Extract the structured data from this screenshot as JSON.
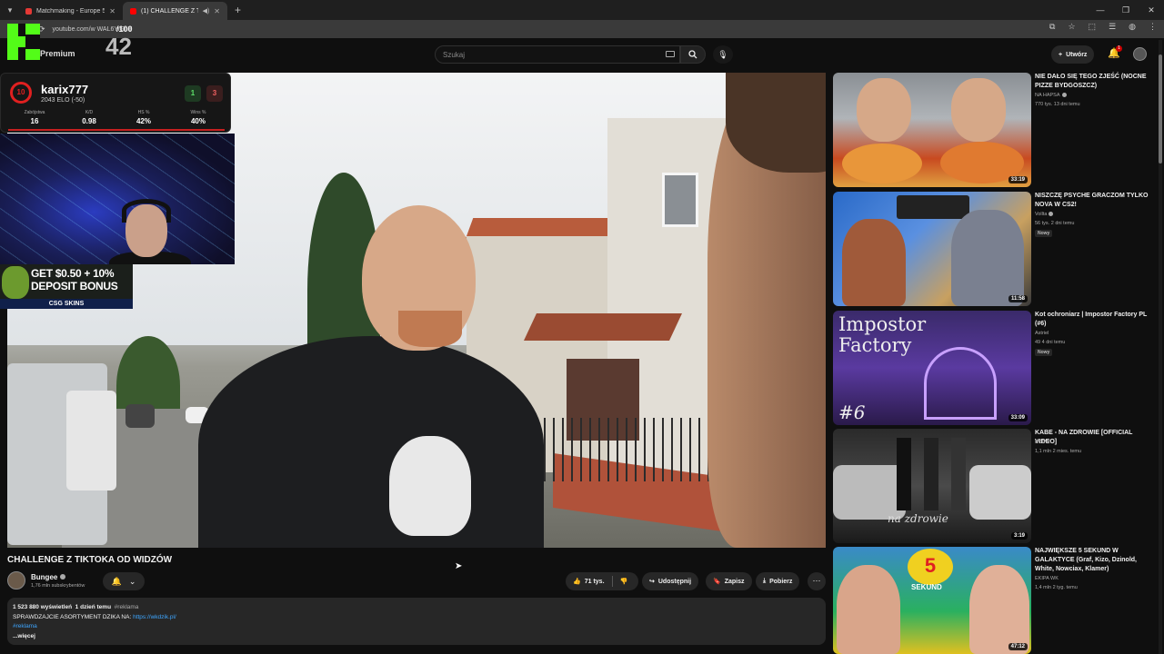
{
  "browser": {
    "tabs": [
      {
        "title": "Matchmaking - Europe 5v5 Qu..."
      },
      {
        "title": "(1) CHALLENGE Z TIKTOKA..."
      }
    ],
    "url": "youtube.com/w          WAL6YiGnY"
  },
  "overlay": {
    "brand_label": "Premium",
    "viewers_small": "/100",
    "viewers_big": "42"
  },
  "faceit": {
    "level": "10",
    "name": "karix777",
    "elo": "2043 ELO (-50)",
    "wins": "1",
    "losses": "3",
    "stats": [
      {
        "label": "Zabójstwa",
        "value": "16"
      },
      {
        "label": "K/D",
        "value": "0.98"
      },
      {
        "label": "HS %",
        "value": "42%"
      },
      {
        "label": "Wins %",
        "value": "40%"
      }
    ]
  },
  "ad": {
    "line1": "GET $0.50 + 10%",
    "line2": "DEPOSIT BONUS",
    "footer": "CSG SKINS"
  },
  "header": {
    "search_placeholder": "Szukaj",
    "create_label": "Utwórz",
    "notif_count": "1"
  },
  "video": {
    "title": "CHALLENGE Z TIKTOKA OD WIDZÓW",
    "channel": "Bungee",
    "subscribers": "1,76 mln subskrybentów",
    "likes": "71 tys.",
    "share_label": "Udostępnij",
    "save_label": "Zapisz",
    "download_label": "Pobierz",
    "views": "1 523 880 wyświetleń",
    "date": "1 dzień temu",
    "hashtag_inline": "#reklama",
    "desc_line": "SPRAWDZAJCIE ASORTYMENT DZIKA NA:",
    "desc_link": "https://wkdzik.pl/",
    "desc_hashtag": "#reklama",
    "more_label": "...więcej"
  },
  "recommendations": [
    {
      "title": "NIE DAŁO SIĘ TEGO ZJEŚĆ (NOCNE PIZZE BYDGOSZCZ)",
      "channel": "NA HAPSA",
      "meta": "770 tys.   13 dni temu",
      "duration": "33:19",
      "badge": ""
    },
    {
      "title": "NISZCZĘ PSYCHE GRACZOM TYLKO NOVA W CS2!",
      "channel": "Vollta",
      "meta": "56 tys.   2 dni temu",
      "duration": "11:58",
      "badge": "Nowy"
    },
    {
      "title": "Kot ochroniarz | Impostor Factory PL (#6)",
      "channel": "Astriel",
      "meta": "49   4 dni temu",
      "duration": "33:09",
      "badge": "Nowy"
    },
    {
      "title": "KABE - NA ZDROWIE [OFFICIAL VIDEO]",
      "channel": "BCBW",
      "meta": "1,1 mln   2 mies. temu",
      "duration": "3:19",
      "badge": ""
    },
    {
      "title": "NAJWIĘKSZE 5 SEKUND W GALAKTYCE (Graf, Kizo, Dzinold, White, Nowciax, Klamer)",
      "channel": "EKIPA WK",
      "meta": "1,4 mln   2 tyg. temu",
      "duration": "47:12",
      "badge": ""
    }
  ],
  "thumb_text": {
    "impostor": "Impostor Factory",
    "six": "#6",
    "nazdrowie": "na zdrowie",
    "five": "5",
    "sekund": "SEKUND"
  }
}
